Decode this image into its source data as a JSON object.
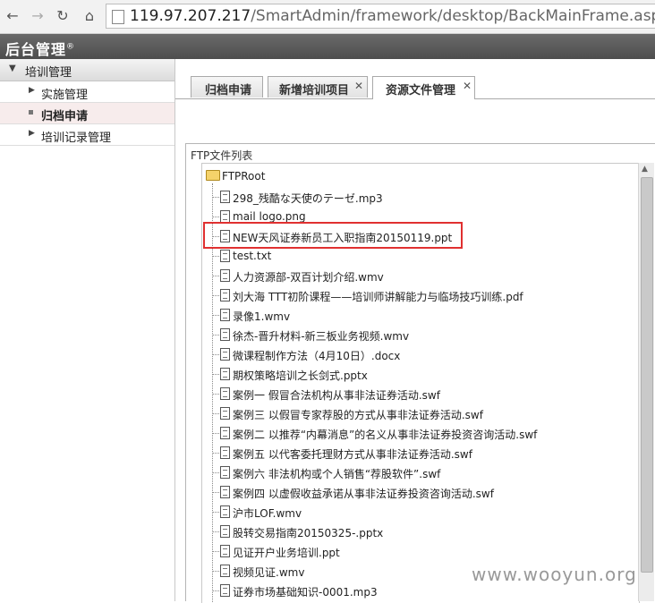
{
  "browser": {
    "back_icon": "arrow-left-icon",
    "forward_icon": "arrow-right-icon",
    "reload_icon": "reload-icon",
    "home_icon": "home-icon",
    "url_host": "119.97.207.217",
    "url_path": "/SmartAdmin/framework/desktop/BackMainFrame.aspx"
  },
  "app": {
    "title": "后台管理",
    "title_mark": "®"
  },
  "sidebar": {
    "group_label": "培训管理",
    "items": [
      {
        "label": "实施管理"
      },
      {
        "label": "归档申请"
      },
      {
        "label": "培训记录管理"
      }
    ]
  },
  "tabs": [
    {
      "label": "归档申请"
    },
    {
      "label": "新增培训项目",
      "close": "✕"
    },
    {
      "label": "资源文件管理",
      "close": "✕"
    }
  ],
  "ftp": {
    "panel_title": "FTP文件列表",
    "root": "FTPRoot",
    "files": [
      "298_残酷な天使のテーゼ.mp3",
      "mail logo.png",
      "NEW天风证券新员工入职指南20150119.ppt",
      "test.txt",
      "人力资源部-双百计划介绍.wmv",
      "刘大海 TTT初阶课程——培训师讲解能力与临场技巧训练.pdf",
      "录像1.wmv",
      "徐杰-晋升材料-新三板业务视频.wmv",
      "微课程制作方法（4月10日）.docx",
      "期权策略培训之长剑式.pptx",
      "案例一 假冒合法机构从事非法证券活动.swf",
      "案例三 以假冒专家荐股的方式从事非法证券活动.swf",
      "案例二 以推荐“内幕消息”的名义从事非法证券投资咨询活动.swf",
      "案例五 以代客委托理财方式从事非法证券活动.swf",
      "案例六 非法机构或个人销售“荐股软件”.swf",
      "案例四 以虚假收益承诺从事非法证券投资咨询活动.swf",
      "沪市LOF.wmv",
      "股转交易指南20150325-.pptx",
      "见证开户业务培训.ppt",
      "视频见证.wmv",
      "证券市场基础知识-0001.mp3"
    ]
  },
  "watermark": "www.wooyun.org"
}
